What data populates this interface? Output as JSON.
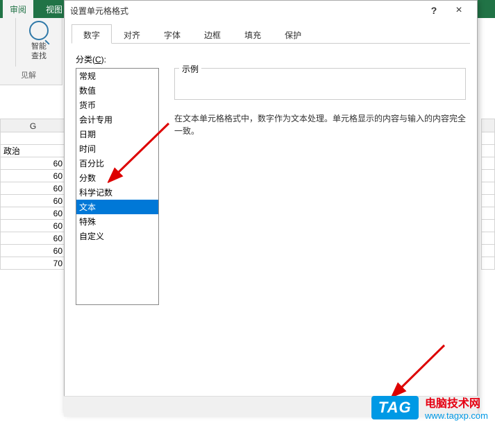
{
  "ribbon": {
    "tab_review": "审阅",
    "tab_view": "视图",
    "smart_lookup": "智能\n查找",
    "group_insights": "见解"
  },
  "sheet": {
    "col_letter": "G",
    "header_text": "政治",
    "values": [
      "60",
      "60",
      "60",
      "60",
      "60",
      "60",
      "60",
      "60",
      "70"
    ]
  },
  "dialog": {
    "title": "设置单元格格式",
    "tabs": [
      "数字",
      "对齐",
      "字体",
      "边框",
      "填充",
      "保护"
    ],
    "active_tab_index": 0,
    "category_label_prefix": "分类(",
    "category_label_key": "C",
    "category_label_suffix": "):",
    "categories": [
      "常规",
      "数值",
      "货币",
      "会计专用",
      "日期",
      "时间",
      "百分比",
      "分数",
      "科学记数",
      "文本",
      "特殊",
      "自定义"
    ],
    "selected_category_index": 9,
    "sample_label": "示例",
    "description": "在文本单元格格式中，数字作为文本处理。单元格显示的内容与输入的内容完全一致。"
  },
  "watermark": {
    "tag": "TAG",
    "cn": "电脑技术网",
    "url": "www.tagxp.com"
  }
}
